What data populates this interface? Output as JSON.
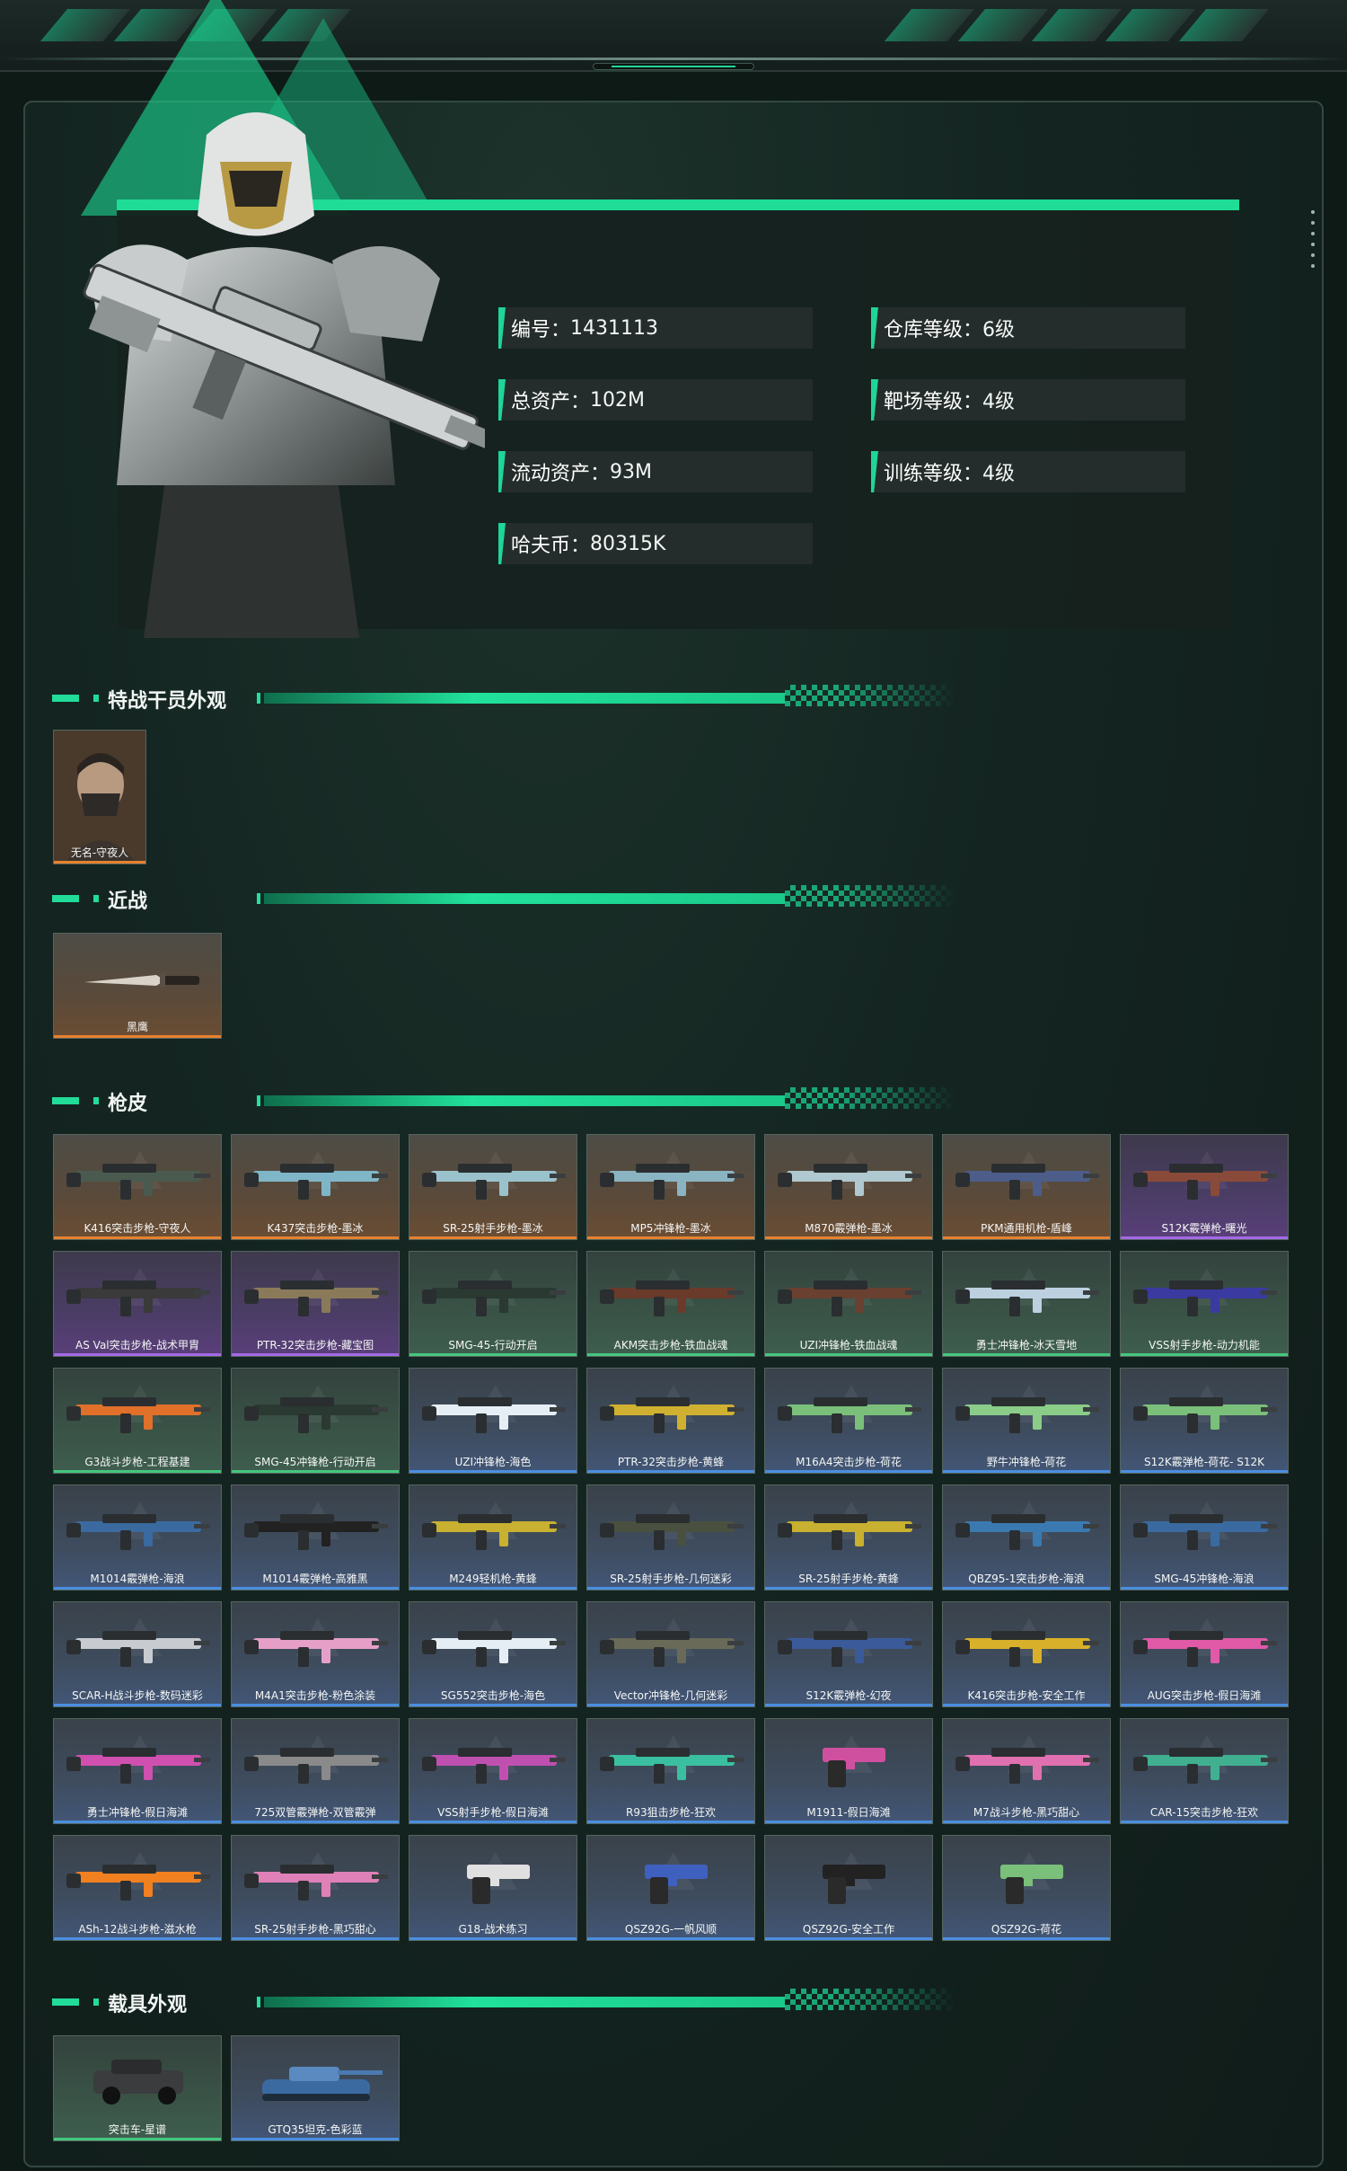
{
  "stats": [
    {
      "label": "编号",
      "value": "1431113"
    },
    {
      "label": "仓库等级",
      "value": "6级"
    },
    {
      "label": "总资产",
      "value": "102M"
    },
    {
      "label": "靶场等级",
      "value": "4级"
    },
    {
      "label": "流动资产",
      "value": "93M"
    },
    {
      "label": "训练等级",
      "value": "4级"
    },
    {
      "label": "哈夫币",
      "value": "80315K"
    }
  ],
  "sections": {
    "operator": {
      "title": "特战干员外观",
      "items": [
        {
          "name": "无名-守夜人",
          "rarity": "orange"
        }
      ]
    },
    "melee": {
      "title": "近战",
      "items": [
        {
          "name": "黑鹰",
          "rarity": "orange"
        }
      ]
    },
    "gunskins": {
      "title": "枪皮",
      "items": [
        {
          "name": "K416突击步枪-守夜人",
          "rarity": "orange",
          "gun_color": "#4a5a4f"
        },
        {
          "name": "K437突击步枪-墨冰",
          "rarity": "orange",
          "gun_color": "#7fb6c7"
        },
        {
          "name": "SR-25射手步枪-墨冰",
          "rarity": "orange",
          "gun_color": "#9ac2cc"
        },
        {
          "name": "MP5冲锋枪-墨冰",
          "rarity": "orange",
          "gun_color": "#8ab4c2"
        },
        {
          "name": "M870霰弹枪-墨冰",
          "rarity": "orange",
          "gun_color": "#b0c8cf"
        },
        {
          "name": "PKM通用机枪-盾峰",
          "rarity": "orange",
          "gun_color": "#4c5d8a"
        },
        {
          "name": "S12K霰弹枪-曙光",
          "rarity": "purple",
          "gun_color": "#8a4a3a"
        },
        {
          "name": "AS Val突击步枪-战术甲胄",
          "rarity": "purple",
          "gun_color": "#3a3a3a"
        },
        {
          "name": "PTR-32突击步枪-藏宝图",
          "rarity": "purple",
          "gun_color": "#8a7a5a"
        },
        {
          "name": "SMG-45-行动开启",
          "rarity": "green",
          "gun_color": "#2a3a32"
        },
        {
          "name": "AKM突击步枪-铁血战魂",
          "rarity": "green",
          "gun_color": "#6a3a2a"
        },
        {
          "name": "UZI冲锋枪-铁血战魂",
          "rarity": "green",
          "gun_color": "#6a4030"
        },
        {
          "name": "勇士冲锋枪-冰天雪地",
          "rarity": "green",
          "gun_color": "#bcd0e0"
        },
        {
          "name": "VSS射手步枪-动力机能",
          "rarity": "green",
          "gun_color": "#3a3aa0"
        },
        {
          "name": "G3战斗步枪-工程基建",
          "rarity": "green",
          "gun_color": "#e0702a"
        },
        {
          "name": "SMG-45冲锋枪-行动开启",
          "rarity": "green",
          "gun_color": "#2a3a32"
        },
        {
          "name": "UZI冲锋枪-海色",
          "rarity": "blue",
          "gun_color": "#e6eef5"
        },
        {
          "name": "PTR-32突击步枪-黄蜂",
          "rarity": "blue",
          "gun_color": "#d0b030"
        },
        {
          "name": "M16A4突击步枪-荷花",
          "rarity": "blue",
          "gun_color": "#7ac07a"
        },
        {
          "name": "野牛冲锋枪-荷花",
          "rarity": "blue",
          "gun_color": "#8acc88"
        },
        {
          "name": "S12K霰弹枪-荷花- S12K",
          "rarity": "blue",
          "gun_color": "#7ac07a"
        },
        {
          "name": "M1014霰弹枪-海浪",
          "rarity": "blue",
          "gun_color": "#3a6aa0"
        },
        {
          "name": "M1014霰弹枪-高雅黑",
          "rarity": "blue",
          "gun_color": "#222222"
        },
        {
          "name": "M249轻机枪-黄蜂",
          "rarity": "blue",
          "gun_color": "#c8b030"
        },
        {
          "name": "SR-25射手步枪-几何迷彩",
          "rarity": "blue",
          "gun_color": "#4a5040"
        },
        {
          "name": "SR-25射手步枪-黄蜂",
          "rarity": "blue",
          "gun_color": "#c8b030"
        },
        {
          "name": "QBZ95-1突击步枪-海浪",
          "rarity": "blue",
          "gun_color": "#3a7ab0"
        },
        {
          "name": "SMG-45冲锋枪-海浪",
          "rarity": "blue",
          "gun_color": "#3a6aa0"
        },
        {
          "name": "SCAR-H战斗步枪-数码迷彩",
          "rarity": "blue",
          "gun_color": "#c8ccd0"
        },
        {
          "name": "M4A1突击步枪-粉色涂装",
          "rarity": "blue",
          "gun_color": "#e6a0c8"
        },
        {
          "name": "SG552突击步枪-海色",
          "rarity": "blue",
          "gun_color": "#e6eef5"
        },
        {
          "name": "Vector冲锋枪-几何迷彩",
          "rarity": "blue",
          "gun_color": "#6a6a58"
        },
        {
          "name": "S12K霰弹枪-幻夜",
          "rarity": "blue",
          "gun_color": "#3a5a9a"
        },
        {
          "name": "K416突击步枪-安全工作",
          "rarity": "blue",
          "gun_color": "#d8b02a"
        },
        {
          "name": "AUG突击步枪-假日海滩",
          "rarity": "blue",
          "gun_color": "#e05aa8"
        },
        {
          "name": "勇士冲锋枪-假日海滩",
          "rarity": "blue",
          "gun_color": "#d050b0"
        },
        {
          "name": "725双管霰弹枪-双管霰弹",
          "rarity": "blue",
          "gun_color": "#8a8a8a"
        },
        {
          "name": "VSS射手步枪-假日海滩",
          "rarity": "blue",
          "gun_color": "#c050b0"
        },
        {
          "name": "R93狙击步枪-狂欢",
          "rarity": "blue",
          "gun_color": "#3ac0a0"
        },
        {
          "name": "M1911-假日海滩",
          "rarity": "blue",
          "gun_color": "#d050a0"
        },
        {
          "name": "M7战斗步枪-黑巧甜心",
          "rarity": "blue",
          "gun_color": "#e070b0"
        },
        {
          "name": "CAR-15突击步枪-狂欢",
          "rarity": "blue",
          "gun_color": "#40b090"
        },
        {
          "name": "ASh-12战斗步枪-滋水枪",
          "rarity": "blue",
          "gun_color": "#f08020"
        },
        {
          "name": "SR-25射手步枪-黑巧甜心",
          "rarity": "blue",
          "gun_color": "#e080b8"
        },
        {
          "name": "G18-战术练习",
          "rarity": "blue",
          "gun_color": "#e0e0e0"
        },
        {
          "name": "QSZ92G-一帆风顺",
          "rarity": "blue",
          "gun_color": "#4060c0"
        },
        {
          "name": "QSZ92G-安全工作",
          "rarity": "blue",
          "gun_color": "#222222"
        },
        {
          "name": "QSZ92G-荷花",
          "rarity": "blue",
          "gun_color": "#7ac07a"
        }
      ]
    },
    "vehicles": {
      "title": "载具外观",
      "items": [
        {
          "name": "突击车-星谱",
          "rarity": "green"
        },
        {
          "name": "GTQ35坦克-色彩蓝",
          "rarity": "blue"
        }
      ]
    }
  },
  "colors": {
    "accent": "#1fdc97",
    "rarity_orange": "#e5822f",
    "rarity_purple": "#a36ae8",
    "rarity_green": "#44c77e",
    "rarity_blue": "#4a8fe0"
  }
}
